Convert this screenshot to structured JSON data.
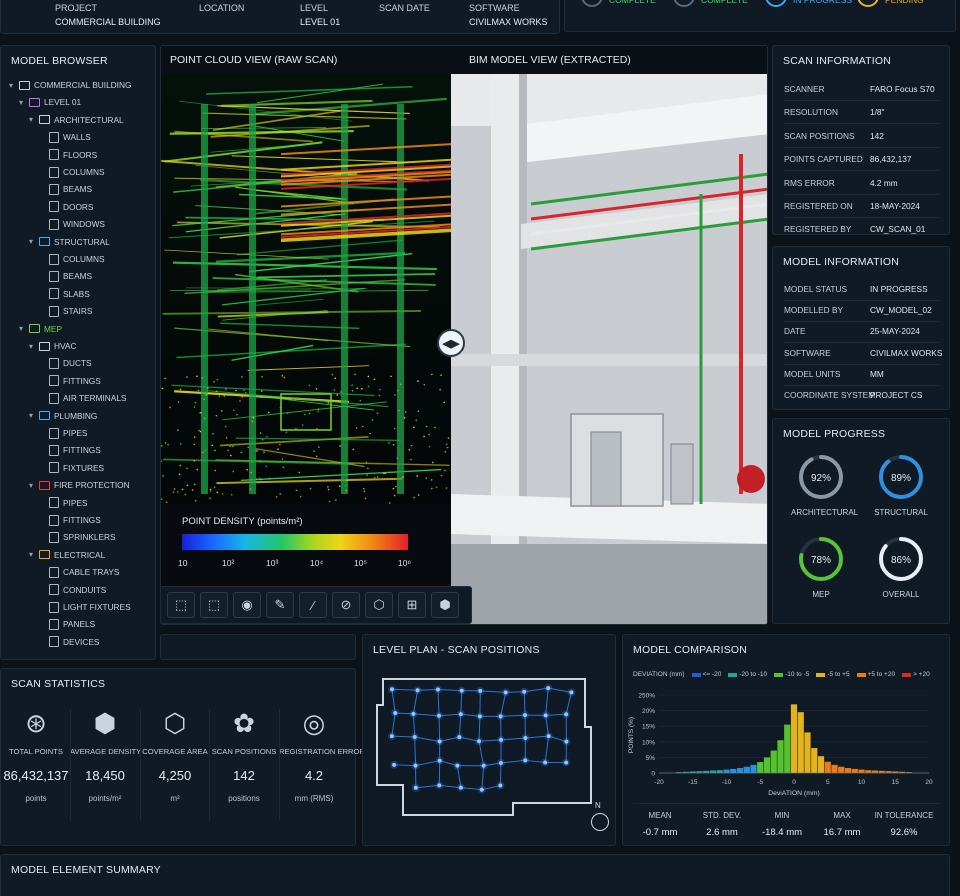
{
  "header": {
    "project_label": "PROJECT",
    "project_value": "COMMERCIAL BUILDING",
    "location_label": "LOCATION",
    "level_label": "LEVEL",
    "level_value": "LEVEL 01",
    "scan_date_label": "SCAN DATE",
    "software_label": "SOFTWARE",
    "software_value": "CIVILMAX WORKS"
  },
  "status_steps": [
    {
      "label": "COMPLETE",
      "color": "#3ddc6a"
    },
    {
      "label": "COMPLETE",
      "color": "#3ddc6a"
    },
    {
      "label": "IN PROGRESS",
      "color": "#3ea8ff"
    },
    {
      "label": "PENDING",
      "color": "#f0a31c"
    }
  ],
  "browser": {
    "title": "MODEL BROWSER",
    "items": [
      {
        "label": "COMMERCIAL BUILDING",
        "indent": 0,
        "kind": "root",
        "caret": "▾"
      },
      {
        "label": "LEVEL 01",
        "indent": 1,
        "kind": "level",
        "caret": "▾"
      },
      {
        "label": "ARCHITECTURAL",
        "indent": 2,
        "kind": "folder",
        "caret": "▾"
      },
      {
        "label": "WALLS",
        "indent": 3,
        "kind": "file"
      },
      {
        "label": "FLOORS",
        "indent": 3,
        "kind": "file"
      },
      {
        "label": "COLUMNS",
        "indent": 3,
        "kind": "file"
      },
      {
        "label": "BEAMS",
        "indent": 3,
        "kind": "file"
      },
      {
        "label": "DOORS",
        "indent": 3,
        "kind": "file"
      },
      {
        "label": "WINDOWS",
        "indent": 3,
        "kind": "file"
      },
      {
        "label": "STRUCTURAL",
        "indent": 2,
        "kind": "folder-blue",
        "caret": "▾"
      },
      {
        "label": "COLUMNS",
        "indent": 3,
        "kind": "file"
      },
      {
        "label": "BEAMS",
        "indent": 3,
        "kind": "file"
      },
      {
        "label": "SLABS",
        "indent": 3,
        "kind": "file"
      },
      {
        "label": "STAIRS",
        "indent": 3,
        "kind": "file"
      },
      {
        "label": "MEP",
        "indent": 1,
        "kind": "folder-green",
        "caret": "▾"
      },
      {
        "label": "HVAC",
        "indent": 2,
        "kind": "folder-white",
        "caret": "▾"
      },
      {
        "label": "DUCTS",
        "indent": 3,
        "kind": "file"
      },
      {
        "label": "FITTINGS",
        "indent": 3,
        "kind": "file"
      },
      {
        "label": "AIR TERMINALS",
        "indent": 3,
        "kind": "file"
      },
      {
        "label": "PLUMBING",
        "indent": 2,
        "kind": "folder-blue",
        "caret": "▾"
      },
      {
        "label": "PIPES",
        "indent": 3,
        "kind": "file"
      },
      {
        "label": "FITTINGS",
        "indent": 3,
        "kind": "file"
      },
      {
        "label": "FIXTURES",
        "indent": 3,
        "kind": "file"
      },
      {
        "label": "FIRE PROTECTION",
        "indent": 2,
        "kind": "folder-red",
        "caret": "▾"
      },
      {
        "label": "PIPES",
        "indent": 3,
        "kind": "file"
      },
      {
        "label": "FITTINGS",
        "indent": 3,
        "kind": "file"
      },
      {
        "label": "SPRINKLERS",
        "indent": 3,
        "kind": "file"
      },
      {
        "label": "ELECTRICAL",
        "indent": 2,
        "kind": "folder-orange",
        "caret": "▾"
      },
      {
        "label": "CABLE TRAYS",
        "indent": 3,
        "kind": "file"
      },
      {
        "label": "CONDUITS",
        "indent": 3,
        "kind": "file"
      },
      {
        "label": "LIGHT FIXTURES",
        "indent": 3,
        "kind": "file"
      },
      {
        "label": "PANELS",
        "indent": 3,
        "kind": "file"
      },
      {
        "label": "DEVICES",
        "indent": 3,
        "kind": "file"
      }
    ]
  },
  "views": {
    "point_cloud_title": "POINT CLOUD VIEW (RAW SCAN)",
    "bim_title": "BIM MODEL VIEW (EXTRACTED)",
    "density_title": "POINT DENSITY (points/m²)",
    "density_ticks": [
      "10",
      "10²",
      "10³",
      "10⁴",
      "10⁵",
      "10⁶"
    ]
  },
  "toolbar": [
    "select-box-icon",
    "select-lasso-icon",
    "camera-icon",
    "pencil-icon",
    "measure-icon",
    "eraser-icon",
    "cube-icon",
    "grid-select-icon",
    "box-3d-icon"
  ],
  "scan_info": {
    "title": "SCAN INFORMATION",
    "rows": [
      {
        "k": "SCANNER",
        "v": "FARO Focus S70"
      },
      {
        "k": "RESOLUTION",
        "v": "1/8\""
      },
      {
        "k": "SCAN POSITIONS",
        "v": "142"
      },
      {
        "k": "POINTS CAPTURED",
        "v": "86,432,137"
      },
      {
        "k": "RMS ERROR",
        "v": "4.2 mm"
      },
      {
        "k": "REGISTERED ON",
        "v": "18-MAY-2024"
      },
      {
        "k": "REGISTERED BY",
        "v": "CW_SCAN_01"
      }
    ]
  },
  "model_info": {
    "title": "MODEL INFORMATION",
    "rows": [
      {
        "k": "MODEL STATUS",
        "v": "IN PROGRESS"
      },
      {
        "k": "MODELLED BY",
        "v": "CW_MODEL_02"
      },
      {
        "k": "DATE",
        "v": "25-MAY-2024"
      },
      {
        "k": "SOFTWARE",
        "v": "CIVILMAX WORKS"
      },
      {
        "k": "MODEL UNITS",
        "v": "MM"
      },
      {
        "k": "COORDINATE SYSTEM",
        "v": "PROJECT CS"
      }
    ]
  },
  "progress": {
    "title": "MODEL PROGRESS",
    "items": [
      {
        "label": "ARCHITECTURAL",
        "pct_text": "92%",
        "pct": 92,
        "color": "#8a97a4"
      },
      {
        "label": "STRUCTURAL",
        "pct_text": "89%",
        "pct": 89,
        "color": "#2f8fe0"
      },
      {
        "label": "MEP",
        "pct_text": "78%",
        "pct": 78,
        "color": "#58c23a"
      },
      {
        "label": "OVERALL",
        "pct_text": "86%",
        "pct": 86,
        "color": "#e8eef3"
      }
    ]
  },
  "stats": {
    "title": "SCAN STATISTICS",
    "items": [
      {
        "label": "TOTAL POINTS",
        "value": "86,432,137",
        "unit": "points",
        "icon": "network-icon"
      },
      {
        "label": "AVERAGE DENSITY",
        "value": "18,450",
        "unit": "points/m²",
        "icon": "lattice-cube-icon"
      },
      {
        "label": "COVERAGE AREA",
        "value": "4,250",
        "unit": "m²",
        "icon": "wire-box-icon"
      },
      {
        "label": "SCAN POSITIONS",
        "value": "142",
        "unit": "positions",
        "icon": "clover-icon"
      },
      {
        "label": "REGISTRATION ERROR",
        "value": "4.2",
        "unit": "mm (RMS)",
        "icon": "target-icon"
      }
    ]
  },
  "plan": {
    "title": "LEVEL PLAN - SCAN POSITIONS",
    "north": "N"
  },
  "comparison": {
    "title": "MODEL COMPARISON",
    "legend_title": "DEVIATION (mm)",
    "summary": [
      {
        "label": "MEAN",
        "value": "-0.7 mm"
      },
      {
        "label": "STD. DEV.",
        "value": "2.6 mm"
      },
      {
        "label": "MIN",
        "value": "-18.4 mm"
      },
      {
        "label": "MAX",
        "value": "16.7 mm"
      },
      {
        "label": "IN TOLERANCE",
        "value": "92.6%"
      }
    ]
  },
  "chart_data": {
    "type": "bar",
    "xlabel": "DeviATION (mm)",
    "ylabel": "POINTS (%)",
    "xlim": [
      -20,
      20
    ],
    "ylim": [
      0,
      25
    ],
    "xticks": [
      "-20",
      "-15",
      "-10",
      "-5",
      "0",
      "5",
      "10",
      "15",
      "20"
    ],
    "yticks": [
      "0",
      "5%",
      "10%",
      "15%",
      "20%",
      "250%"
    ],
    "legend": [
      {
        "name": "<= -20",
        "color": "#2a5bd7"
      },
      {
        "name": "-20 to -10",
        "color": "#1fa6a0"
      },
      {
        "name": "-10 to -5",
        "color": "#56c22d"
      },
      {
        "name": "-5 to +5",
        "color": "#e3b21c"
      },
      {
        "name": "+5 to +20",
        "color": "#ec7a16"
      },
      {
        "name": "> +20",
        "color": "#e0242a"
      }
    ],
    "x": [
      -17,
      -16,
      -15,
      -14,
      -13,
      -12,
      -11,
      -10,
      -9,
      -8,
      -7,
      -6,
      -5,
      -4,
      -3,
      -2,
      -1,
      0,
      1,
      2,
      3,
      4,
      5,
      6,
      7,
      8,
      9,
      10,
      11,
      12,
      13,
      14,
      15,
      16,
      17
    ],
    "values": [
      0.3,
      0.4,
      0.5,
      0.6,
      0.7,
      0.8,
      0.9,
      1.1,
      1.3,
      1.6,
      2.0,
      2.6,
      3.5,
      5.0,
      7.2,
      10.5,
      15.5,
      22.0,
      19.5,
      13.0,
      8.0,
      5.4,
      3.6,
      2.6,
      2.0,
      1.6,
      1.3,
      1.1,
      0.9,
      0.8,
      0.7,
      0.6,
      0.5,
      0.4,
      0.3
    ]
  },
  "summary": {
    "title": "MODEL ELEMENT SUMMARY"
  }
}
